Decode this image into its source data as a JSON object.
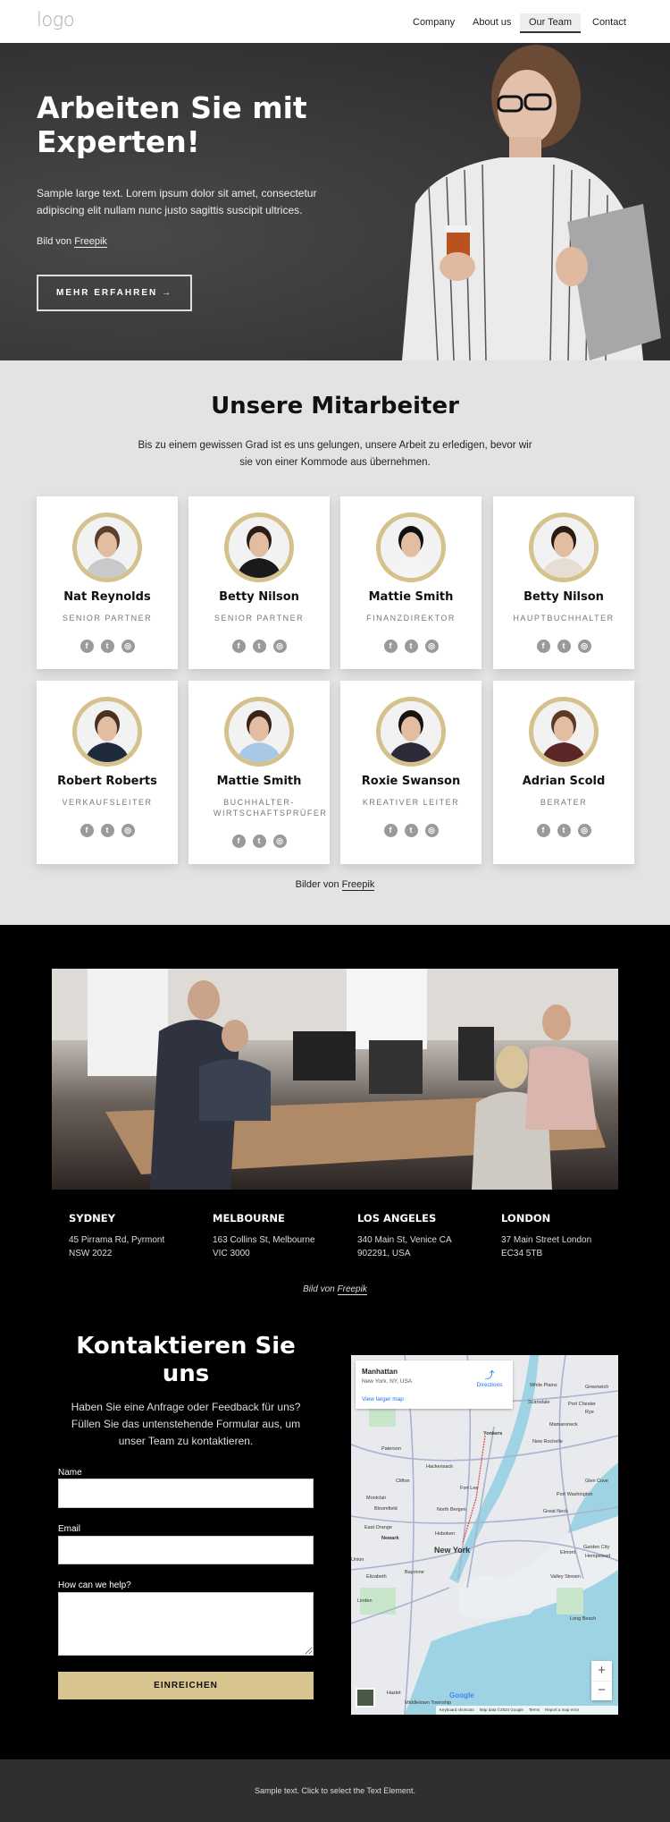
{
  "nav": {
    "logo": "logo",
    "items": [
      {
        "label": "Company",
        "active": false
      },
      {
        "label": "About us",
        "active": false
      },
      {
        "label": "Our Team",
        "active": true
      },
      {
        "label": "Contact",
        "active": false
      }
    ]
  },
  "hero": {
    "title": "Arbeiten Sie mit Experten!",
    "text": "Sample large text. Lorem ipsum dolor sit amet, consectetur adipiscing elit nullam nunc justo sagittis suscipit ultrices.",
    "credit_prefix": "Bild von ",
    "credit_link": "Freepik",
    "button": "MEHR ERFAHREN →"
  },
  "team": {
    "title": "Unsere Mitarbeiter",
    "description": "Bis zu einem gewissen Grad ist es uns gelungen, unsere Arbeit zu erledigen, bevor wir sie von einer Kommode aus übernehmen.",
    "members": [
      {
        "name": "Nat Reynolds",
        "role": "SENIOR PARTNER",
        "hair": "#5a3d2b",
        "shirt": "#c9c9c9"
      },
      {
        "name": "Betty Nilson",
        "role": "SENIOR PARTNER",
        "hair": "#2a1d17",
        "shirt": "#1a1a1a"
      },
      {
        "name": "Mattie Smith",
        "role": "FINANZDIREKTOR",
        "hair": "#111",
        "shirt": "#f4f4f4"
      },
      {
        "name": "Betty Nilson",
        "role": "HAUPTBUCHHALTER",
        "hair": "#2a1a10",
        "shirt": "#e6ddd3"
      },
      {
        "name": "Robert Roberts",
        "role": "VERKAUFSLEITER",
        "hair": "#4a3020",
        "shirt": "#1f2a3d"
      },
      {
        "name": "Mattie Smith",
        "role": "BUCHHALTER-WIRTSCHAFTSPRÜFER",
        "hair": "#3a2418",
        "shirt": "#a9c8e6"
      },
      {
        "name": "Roxie Swanson",
        "role": "KREATIVER LEITER",
        "hair": "#1a1210",
        "shirt": "#2b2b3a"
      },
      {
        "name": "Adrian Scold",
        "role": "BERATER",
        "hair": "#5a3a24",
        "shirt": "#5a2626"
      }
    ],
    "social_icons": [
      "facebook-icon",
      "twitter-icon",
      "instagram-icon"
    ],
    "credit_prefix": "Bilder von ",
    "credit_link": "Freepik"
  },
  "offices": [
    {
      "city": "SYDNEY",
      "line1": "45 Pirrama Rd, Pyrmont",
      "line2": "NSW 2022"
    },
    {
      "city": "MELBOURNE",
      "line1": "163 Collins St, Melbourne",
      "line2": "VIC 3000"
    },
    {
      "city": "LOS ANGELES",
      "line1": "340 Main St, Venice CA",
      "line2": "902291, USA"
    },
    {
      "city": "LONDON",
      "line1": "37 Main Street London",
      "line2": "EC34 5TB"
    }
  ],
  "offices_credit": {
    "prefix": "Bild von ",
    "link": "Freepik"
  },
  "contact": {
    "title": "Kontaktieren Sie uns",
    "description": "Haben Sie eine Anfrage oder Feedback für uns? Füllen Sie das untenstehende Formular aus, um unser Team zu kontaktieren.",
    "name_label": "Name",
    "email_label": "Email",
    "help_label": "How can we help?",
    "name_value": "",
    "email_value": "",
    "help_value": "",
    "submit": "EINREICHEN"
  },
  "map": {
    "place": "Manhattan",
    "address": "New York, NY, USA",
    "directions": "Directions",
    "larger": "View larger map",
    "zoom_in": "+",
    "zoom_out": "−",
    "google": "Google",
    "keyboard": "Keyboard shortcuts",
    "mapdata": "Map data ©2024 Google",
    "terms": "Terms",
    "report": "Report a map error",
    "labels": [
      "White Plains",
      "Greenwich",
      "Scarsdale",
      "Port Chester",
      "Rye",
      "Mamaroneck",
      "Yonkers",
      "New Rochelle",
      "Paterson",
      "Hackensack",
      "Clifton",
      "Fort Lee",
      "Glen Cove",
      "Port Washington",
      "Montclair",
      "Bloomfield",
      "North Bergen",
      "Great Neck",
      "East Orange",
      "Newark",
      "Hoboken",
      "New York",
      "Garden City",
      "Elmont",
      "Hempstead",
      "Union",
      "Elizabeth",
      "Bayonne",
      "Valley Stream",
      "Linden",
      "Long Beach",
      "Hazlet",
      "Middletown Township"
    ]
  },
  "footer": {
    "text": "Sample text. Click to select the Text Element."
  },
  "colors": {
    "accent": "#d8c48e",
    "hero_bg": "#3a3838",
    "team_bg": "#e3e3e3",
    "dark_bg": "#000000",
    "footer_bg": "#2f2f2f"
  }
}
